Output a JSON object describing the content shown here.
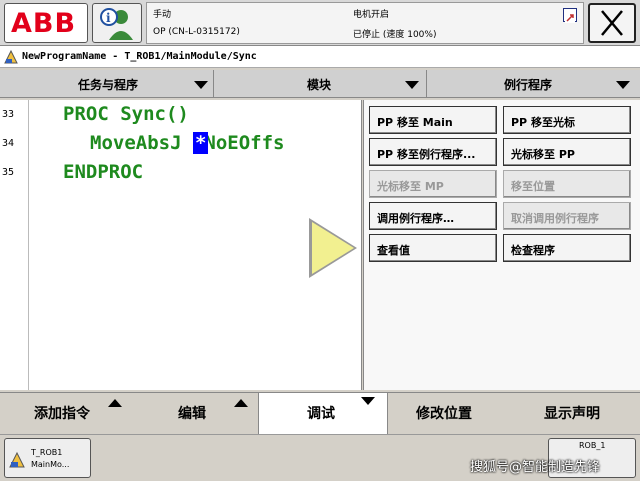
{
  "topbar": {
    "logo_text": "ABB",
    "mode": "手动",
    "controller": "OP (CN-L-0315172)",
    "motor_state": "电机开启",
    "run_state": "已停止 (速度 100%)"
  },
  "path": "NewProgramName - T_ROB1/MainModule/Sync",
  "tabs": [
    {
      "label": "任务与程序"
    },
    {
      "label": "模块"
    },
    {
      "label": "例行程序"
    }
  ],
  "editor": {
    "line_numbers": [
      "33",
      "34",
      "35"
    ],
    "line1": "PROC Sync()",
    "line2_pre": "MoveAbsJ ",
    "cursor": "*",
    "line2_post": "\\NoEOffs",
    "line3": "ENDPROC"
  },
  "menu": {
    "pp_to_main": "PP 移至 Main",
    "pp_to_cursor": "PP 移至光标",
    "pp_to_routine": "PP 移至例行程序...",
    "cursor_to_pp": "光标移至 PP",
    "cursor_to_mp": "光标移至 MP",
    "move_to_pos": "移至位置",
    "call_routine": "调用例行程序…",
    "cancel_call": "取消调用例行程序",
    "view_value": "查看值",
    "check_program": "检查程序"
  },
  "bottom": {
    "add_instruction": "添加指令",
    "edit": "编辑",
    "debug": "调试",
    "modify_position": "修改位置",
    "show_declaration": "显示声明"
  },
  "taskbar": {
    "task_line1": "T_ROB1",
    "task_line2": "MainMo...",
    "rob_label": "ROB_1"
  },
  "watermark": "搜狐号@智能制造先锋"
}
